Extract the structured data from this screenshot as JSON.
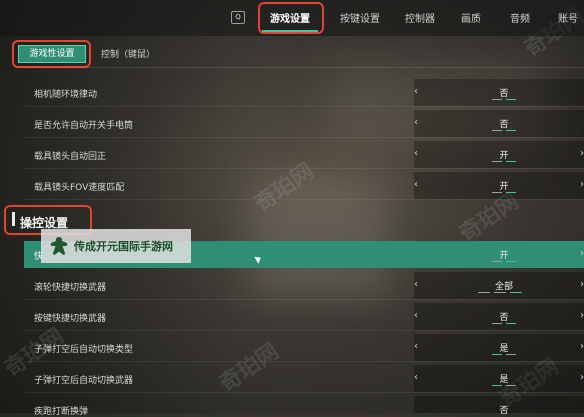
{
  "topbar": {
    "q_key": "Q",
    "tabs": [
      {
        "label": "游戏设置",
        "active": true
      },
      {
        "label": "按键设置"
      },
      {
        "label": "控制器"
      },
      {
        "label": "画质"
      },
      {
        "label": "音频"
      },
      {
        "label": "账号"
      }
    ]
  },
  "subtabs": {
    "active": "游戏性设置",
    "other": "控制（键鼠）"
  },
  "rows_top": [
    {
      "label": "相机随环境律动",
      "value": "否",
      "arrows": "left"
    },
    {
      "label": "是否允许自动开关手电筒",
      "value": "否",
      "arrows": "left"
    },
    {
      "label": "载具镜头自动回正",
      "value": "开",
      "arrows": "both"
    },
    {
      "label": "载具镜头FOV速度匹配",
      "value": "开",
      "arrows": "both"
    }
  ],
  "section": {
    "title": "操控设置"
  },
  "rows_bottom": [
    {
      "label": "快",
      "value": "开",
      "arrows": "right",
      "selected": true
    },
    {
      "label": "滚轮快捷切换武器",
      "value": "全部",
      "arrows": "both"
    },
    {
      "label": "按键快捷切换武器",
      "value": "否",
      "arrows": "both"
    },
    {
      "label": "子弹打空后自动切换类型",
      "value": "是",
      "arrows": "both"
    },
    {
      "label": "子弹打空后自动切换武器",
      "value": "是",
      "arrows": "both"
    },
    {
      "label": "疾跑打断换弹",
      "value": "否",
      "arrows": "both"
    }
  ],
  "watermark": {
    "text": "传成开元国际手游网",
    "faint": "奇珀网"
  },
  "colors": {
    "accent": "#2f8e74",
    "highlight": "#e2442f"
  }
}
